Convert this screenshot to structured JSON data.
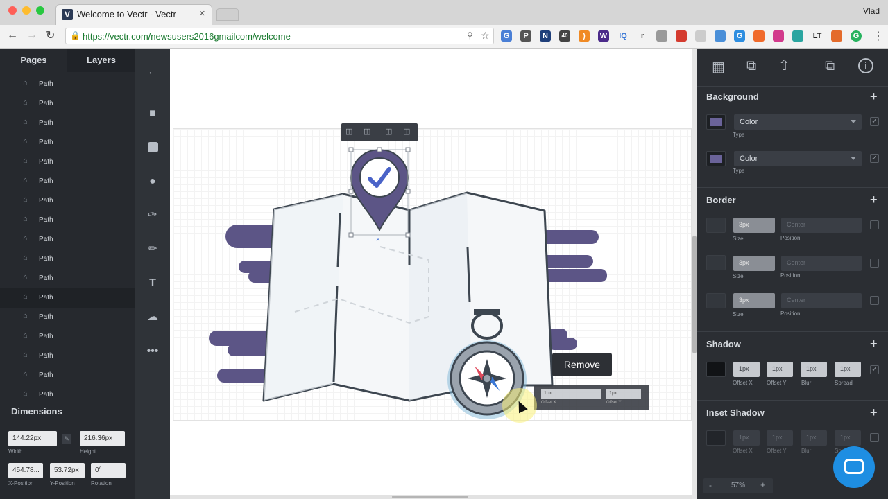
{
  "browser": {
    "tab_title": "Welcome to Vectr - Vectr",
    "tab_close": "×",
    "url": "https://vectr.com/newsusers2016gmailcom/welcome",
    "profile_name": "Vlad",
    "favicon_letter": "V",
    "colors": {
      "close": "#ff5f57",
      "minimize": "#febc2e",
      "maximize": "#28c840"
    }
  },
  "left_panel": {
    "tabs": [
      "Pages",
      "Layers"
    ],
    "layer_items": [
      "Path",
      "Path",
      "Path",
      "Path",
      "Path",
      "Path",
      "Path",
      "Path",
      "Path",
      "Path",
      "Path",
      "Path",
      "Path",
      "Path",
      "Path",
      "Path",
      "Path"
    ],
    "dimensions": {
      "title": "Dimensions",
      "width_value": "144.22px",
      "width_label": "Width",
      "height_value": "216.36px",
      "height_label": "Height",
      "x_value": "454.78...",
      "x_label": "X-Position",
      "y_value": "53.72px",
      "y_label": "Y-Position",
      "rotation_value": "0°",
      "rotation_label": "Rotation"
    }
  },
  "tools": [
    "back-arrow",
    "rectangle",
    "rounded-rectangle",
    "ellipse",
    "pen",
    "pencil",
    "text",
    "upload",
    "more"
  ],
  "canvas": {
    "remove_tooltip": "Remove",
    "mini_labels": {
      "x_value": "1px",
      "y_value": "1px",
      "x_label": "Offset X",
      "y_label": "Offset Y"
    }
  },
  "right_panel": {
    "background": {
      "title": "Background",
      "rows": [
        {
          "type_value": "Color",
          "type_label": "Type"
        },
        {
          "type_value": "Color",
          "type_label": "Type"
        }
      ]
    },
    "border": {
      "title": "Border",
      "rows": [
        {
          "size": "3px",
          "size_label": "Size",
          "position": "Center",
          "position_label": "Position"
        },
        {
          "size": "3px",
          "size_label": "Size",
          "position": "Center",
          "position_label": "Position"
        },
        {
          "size": "3px",
          "size_label": "Size",
          "position": "Center",
          "position_label": "Position"
        }
      ]
    },
    "shadow": {
      "title": "Shadow",
      "values": [
        "1px",
        "1px",
        "1px",
        "1px"
      ],
      "labels": [
        "Offset X",
        "Offset Y",
        "Blur",
        "Spread"
      ]
    },
    "inset_shadow": {
      "title": "Inset Shadow",
      "values": [
        "1px",
        "1px",
        "1px",
        "1px"
      ],
      "labels": [
        "Offset X",
        "Offset Y",
        "Blur",
        "Spread"
      ]
    },
    "zoom": {
      "value": "57%",
      "minus": "-",
      "plus": "+"
    }
  }
}
